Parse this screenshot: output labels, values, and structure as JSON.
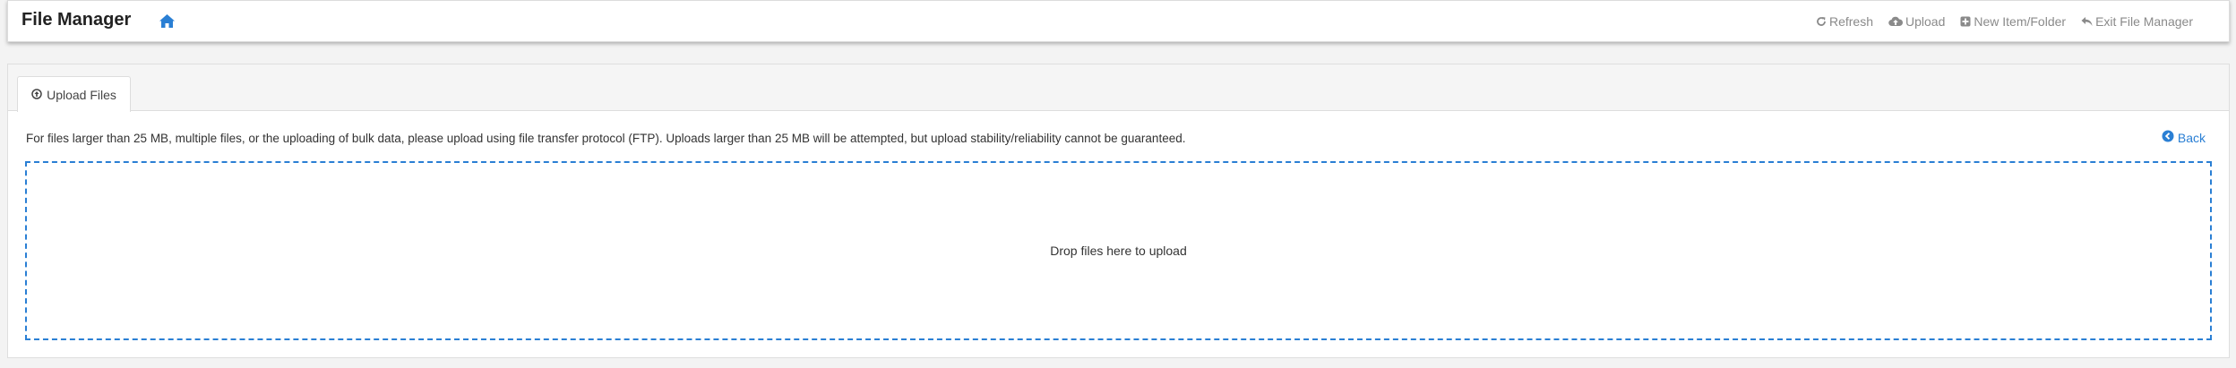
{
  "header": {
    "title": "File Manager",
    "home_icon": "home-icon",
    "actions": [
      {
        "label": "Refresh",
        "icon": "refresh-icon"
      },
      {
        "label": "Upload",
        "icon": "cloud-upload-icon"
      },
      {
        "label": "New Item/Folder",
        "icon": "plus-square-icon"
      },
      {
        "label": "Exit File Manager",
        "icon": "reply-icon"
      }
    ]
  },
  "tabs": [
    {
      "label": "Upload Files",
      "icon": "arrow-circle-up-icon",
      "active": true
    }
  ],
  "upload": {
    "notice": "For files larger than 25 MB, multiple files, or the uploading of bulk data, please upload using file transfer protocol (FTP). Uploads larger than 25 MB will be attempted, but upload stability/reliability cannot be guaranteed.",
    "back_label": "Back",
    "dropzone_text": "Drop files here to upload"
  },
  "colors": {
    "accent": "#2a7fd4",
    "muted_text": "#8a8a8a"
  }
}
